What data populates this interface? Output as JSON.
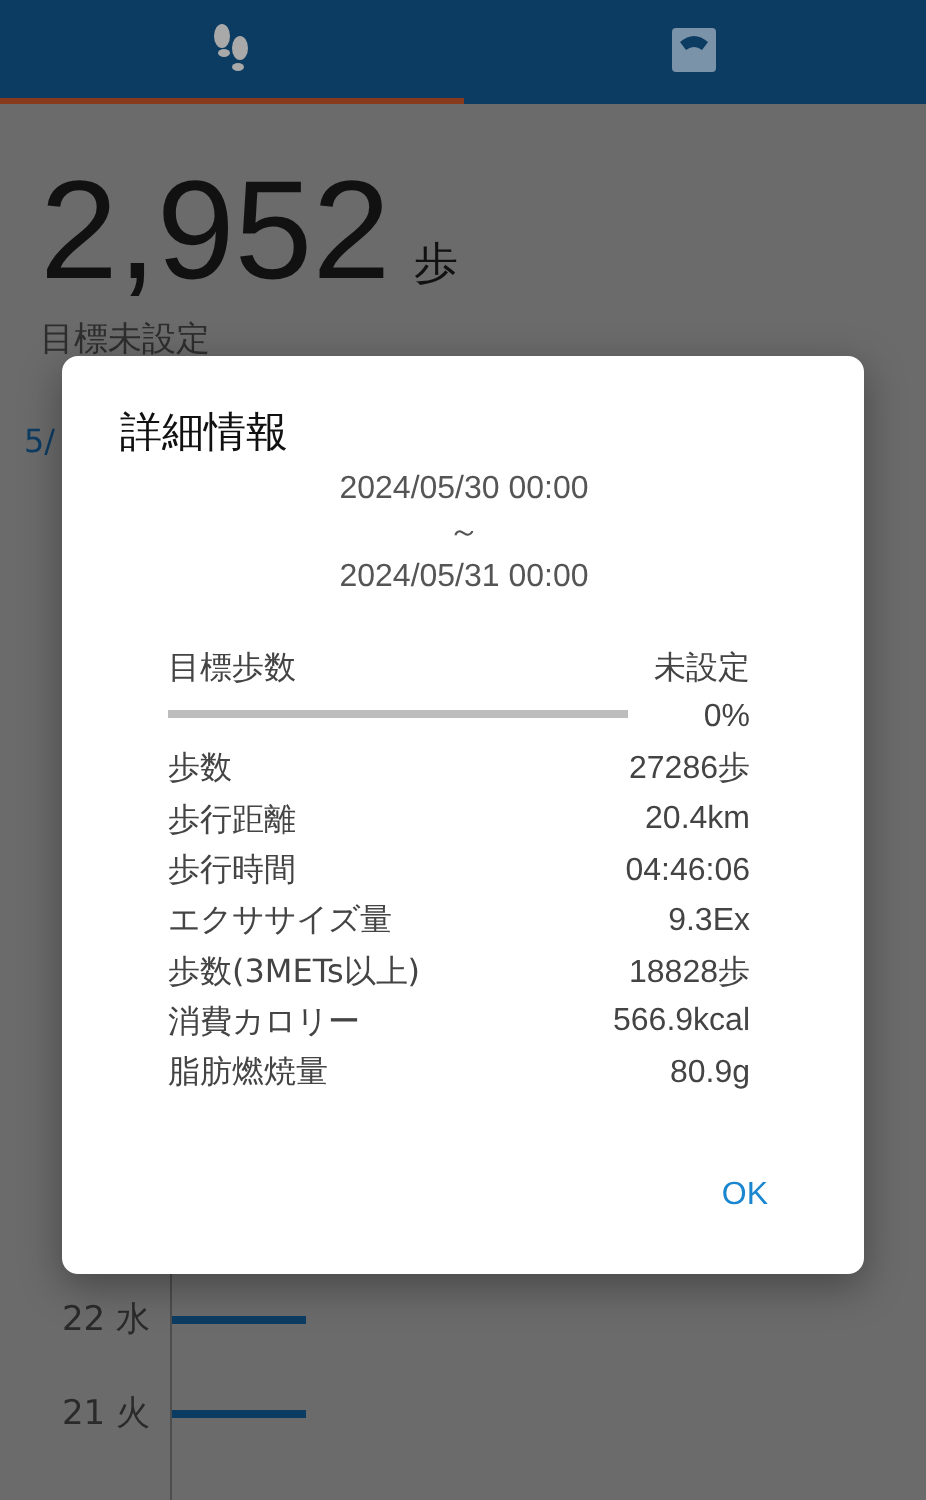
{
  "tabs": [
    {
      "selected": true
    },
    {
      "selected": false
    }
  ],
  "steps": {
    "value": "2,952",
    "unit": "歩",
    "goal_text": "目標未設定"
  },
  "chart": {
    "header": "5/",
    "rows": [
      {
        "label": "22 水"
      },
      {
        "label": "21 火"
      }
    ]
  },
  "dialog": {
    "title": "詳細情報",
    "start": "2024/05/30 00:00",
    "separator": "～",
    "end": "2024/05/31 00:00",
    "goal": {
      "label": "目標歩数",
      "value": "未設定",
      "percent": "0%"
    },
    "rows": [
      {
        "label": "歩数",
        "value": "27286歩"
      },
      {
        "label": "歩行距離",
        "value": "20.4km"
      },
      {
        "label": "歩行時間",
        "value": "04:46:06"
      },
      {
        "label": "エクササイズ量",
        "value": "9.3Ex"
      },
      {
        "label": "歩数(3METs以上)",
        "value": "18828歩"
      },
      {
        "label": "消費カロリー",
        "value": "566.9kcal"
      },
      {
        "label": "脂肪燃焼量",
        "value": "80.9g"
      }
    ],
    "buttons": [
      "OK"
    ]
  }
}
